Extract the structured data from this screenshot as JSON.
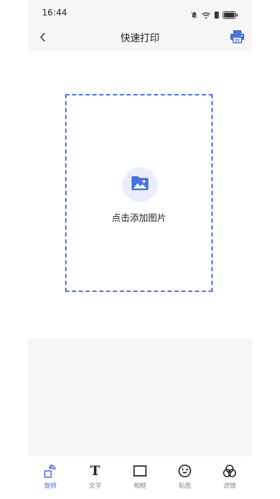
{
  "status_bar": {
    "time": "16:44"
  },
  "nav": {
    "title": "快速打印"
  },
  "canvas": {
    "add_label": "点击添加图片"
  },
  "toolbar": {
    "items": [
      {
        "label": "旋转",
        "icon": "rotate-icon",
        "active": true
      },
      {
        "label": "文字",
        "icon": "text-icon",
        "active": false
      },
      {
        "label": "相框",
        "icon": "frame-icon",
        "active": false
      },
      {
        "label": "贴图",
        "icon": "sticker-icon",
        "active": false
      },
      {
        "label": "滤镜",
        "icon": "filter-icon",
        "active": false
      }
    ]
  },
  "colors": {
    "accent": "#4a72d9",
    "accent_light": "#e9eefa",
    "panel_bg": "#f6f6f6",
    "text": "#222222",
    "muted": "#888888"
  }
}
